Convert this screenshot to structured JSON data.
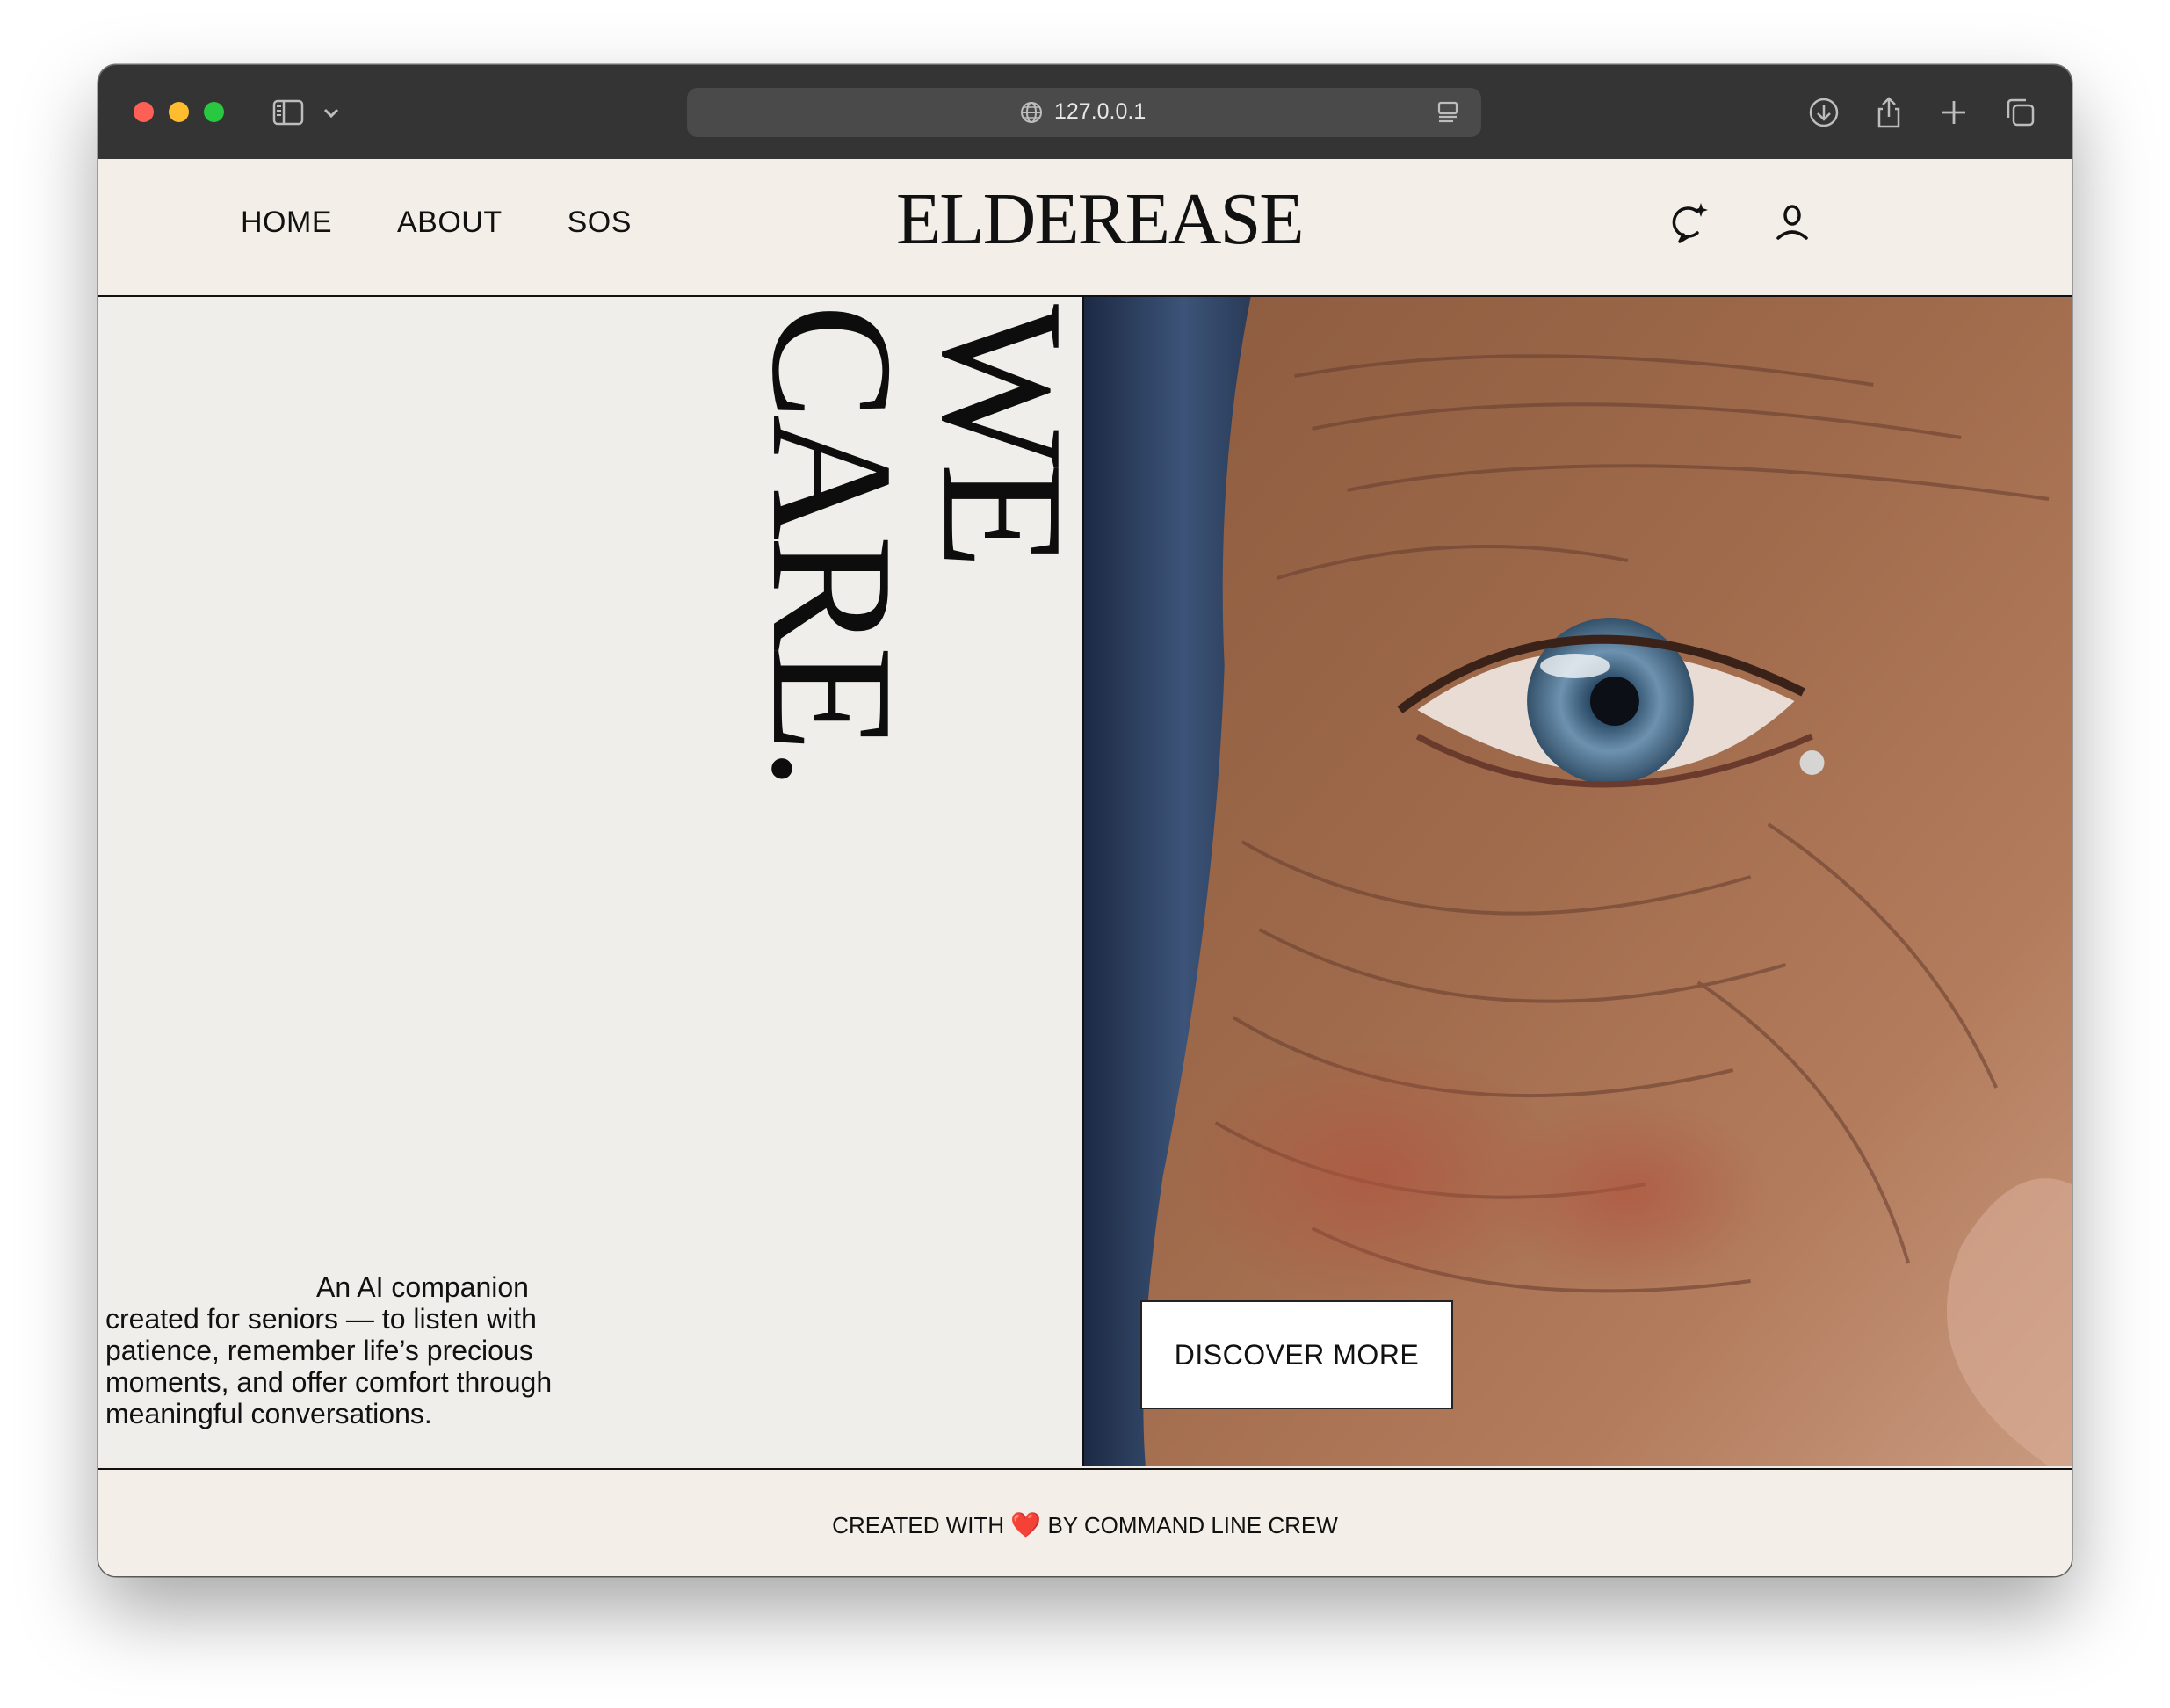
{
  "browser": {
    "url": "127.0.0.1"
  },
  "nav": {
    "items": [
      "HOME",
      "ABOUT",
      "SOS"
    ]
  },
  "brand": "ELDEREASE",
  "hero": {
    "title_line1": "WE",
    "title_line2": "CARE.",
    "description": "An AI companion created for seniors — to listen with patience, remember life’s precious moments, and offer comfort through meaningful conversations.",
    "cta_label": "DISCOVER MORE"
  },
  "footer": {
    "prefix": "CREATED WITH",
    "heart": "❤️",
    "suffix": "BY COMMAND LINE CREW"
  },
  "icons": {
    "browser": [
      "sidebar-icon",
      "chevron-down-icon",
      "globe-icon",
      "reader-icon",
      "download-icon",
      "share-icon",
      "plus-icon",
      "tabs-icon"
    ],
    "header": [
      "chat-sparkle-icon",
      "user-icon"
    ]
  },
  "colors": {
    "page_bg": "#f3eee7",
    "hero_bg": "#f0eeea",
    "ink": "#111111",
    "toolbar": "#343434",
    "heart": "#e22b2b"
  }
}
